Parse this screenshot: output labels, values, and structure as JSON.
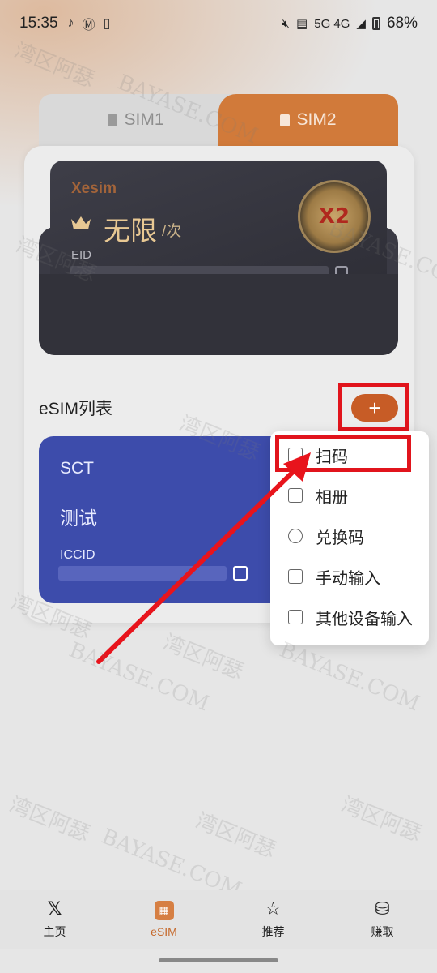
{
  "status_bar": {
    "time": "15:35",
    "network": "5G 4G",
    "battery": "68%"
  },
  "sim_tabs": [
    {
      "label": "SIM1",
      "active": false
    },
    {
      "label": "SIM2",
      "active": true
    }
  ],
  "card": {
    "brand": "Xesim",
    "plan_name": "无限",
    "plan_unit": "/次",
    "eid_label": "EID",
    "badge_text": "X2"
  },
  "esim_list": {
    "title": "eSIM列表",
    "add_label": "+",
    "items": [
      {
        "carrier": "SCT",
        "name": "测试",
        "iccid_label": "ICCID"
      }
    ]
  },
  "add_menu": {
    "items": [
      {
        "label": "扫码",
        "icon": "scan-icon"
      },
      {
        "label": "相册",
        "icon": "image-icon"
      },
      {
        "label": "兑换码",
        "icon": "exchange-icon"
      },
      {
        "label": "手动输入",
        "icon": "edit-icon"
      },
      {
        "label": "其他设备输入",
        "icon": "device-icon"
      }
    ]
  },
  "watermark": {
    "text_cn": "湾区阿瑟",
    "text_en": "BAYASE.COM"
  },
  "bottom_nav": [
    {
      "label": "主页",
      "icon": "x-logo-icon"
    },
    {
      "label": "eSIM",
      "icon": "sim-icon",
      "active": true
    },
    {
      "label": "推荐",
      "icon": "star-icon"
    },
    {
      "label": "赚取",
      "icon": "coins-icon"
    }
  ],
  "colors": {
    "accent": "#c75c26",
    "tab_active": "#d17a3a",
    "esim_card": "#3d4cab",
    "highlight": "#e1141c"
  }
}
